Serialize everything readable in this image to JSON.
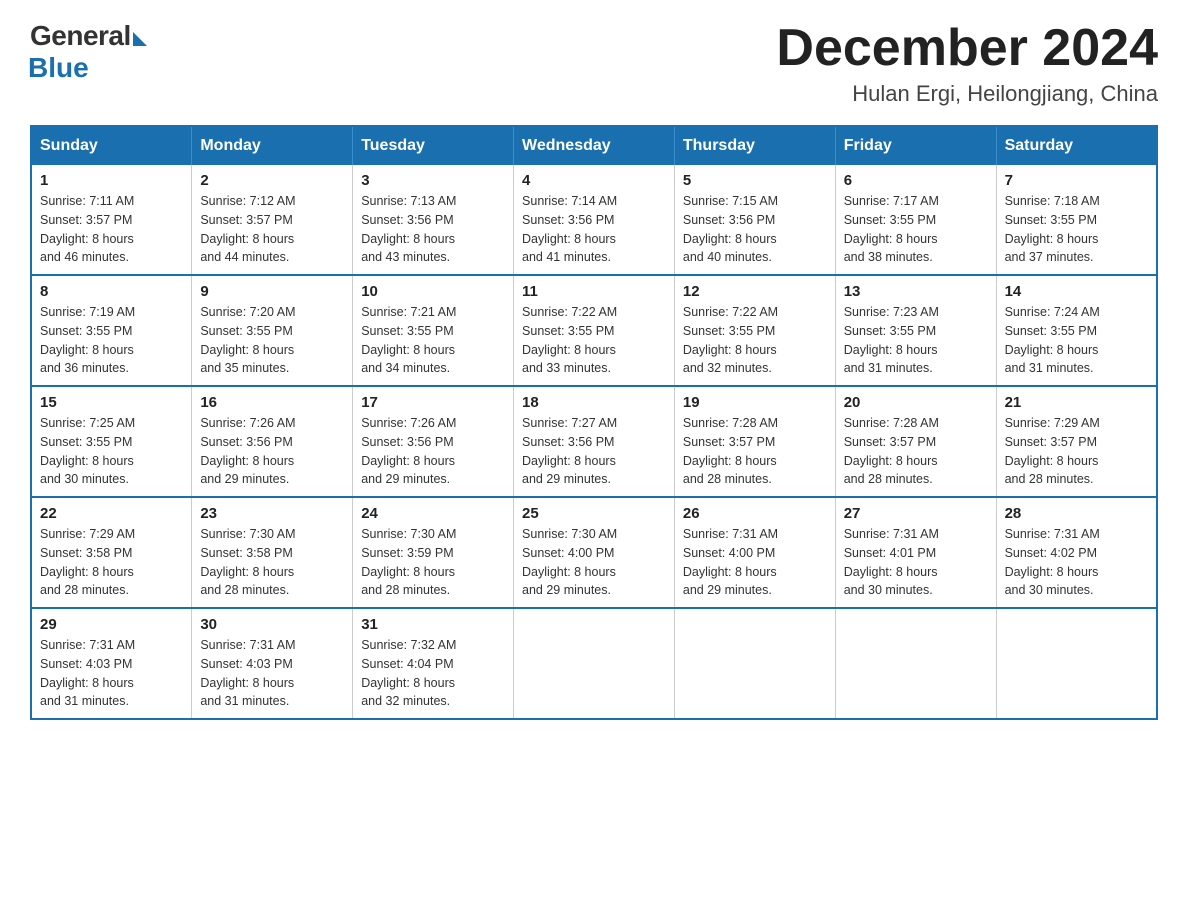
{
  "header": {
    "logo_general": "General",
    "logo_blue": "Blue",
    "month_title": "December 2024",
    "location": "Hulan Ergi, Heilongjiang, China"
  },
  "days_of_week": [
    "Sunday",
    "Monday",
    "Tuesday",
    "Wednesday",
    "Thursday",
    "Friday",
    "Saturday"
  ],
  "weeks": [
    [
      {
        "day": "1",
        "sunrise": "7:11 AM",
        "sunset": "3:57 PM",
        "daylight": "8 hours and 46 minutes."
      },
      {
        "day": "2",
        "sunrise": "7:12 AM",
        "sunset": "3:57 PM",
        "daylight": "8 hours and 44 minutes."
      },
      {
        "day": "3",
        "sunrise": "7:13 AM",
        "sunset": "3:56 PM",
        "daylight": "8 hours and 43 minutes."
      },
      {
        "day": "4",
        "sunrise": "7:14 AM",
        "sunset": "3:56 PM",
        "daylight": "8 hours and 41 minutes."
      },
      {
        "day": "5",
        "sunrise": "7:15 AM",
        "sunset": "3:56 PM",
        "daylight": "8 hours and 40 minutes."
      },
      {
        "day": "6",
        "sunrise": "7:17 AM",
        "sunset": "3:55 PM",
        "daylight": "8 hours and 38 minutes."
      },
      {
        "day": "7",
        "sunrise": "7:18 AM",
        "sunset": "3:55 PM",
        "daylight": "8 hours and 37 minutes."
      }
    ],
    [
      {
        "day": "8",
        "sunrise": "7:19 AM",
        "sunset": "3:55 PM",
        "daylight": "8 hours and 36 minutes."
      },
      {
        "day": "9",
        "sunrise": "7:20 AM",
        "sunset": "3:55 PM",
        "daylight": "8 hours and 35 minutes."
      },
      {
        "day": "10",
        "sunrise": "7:21 AM",
        "sunset": "3:55 PM",
        "daylight": "8 hours and 34 minutes."
      },
      {
        "day": "11",
        "sunrise": "7:22 AM",
        "sunset": "3:55 PM",
        "daylight": "8 hours and 33 minutes."
      },
      {
        "day": "12",
        "sunrise": "7:22 AM",
        "sunset": "3:55 PM",
        "daylight": "8 hours and 32 minutes."
      },
      {
        "day": "13",
        "sunrise": "7:23 AM",
        "sunset": "3:55 PM",
        "daylight": "8 hours and 31 minutes."
      },
      {
        "day": "14",
        "sunrise": "7:24 AM",
        "sunset": "3:55 PM",
        "daylight": "8 hours and 31 minutes."
      }
    ],
    [
      {
        "day": "15",
        "sunrise": "7:25 AM",
        "sunset": "3:55 PM",
        "daylight": "8 hours and 30 minutes."
      },
      {
        "day": "16",
        "sunrise": "7:26 AM",
        "sunset": "3:56 PM",
        "daylight": "8 hours and 29 minutes."
      },
      {
        "day": "17",
        "sunrise": "7:26 AM",
        "sunset": "3:56 PM",
        "daylight": "8 hours and 29 minutes."
      },
      {
        "day": "18",
        "sunrise": "7:27 AM",
        "sunset": "3:56 PM",
        "daylight": "8 hours and 29 minutes."
      },
      {
        "day": "19",
        "sunrise": "7:28 AM",
        "sunset": "3:57 PM",
        "daylight": "8 hours and 28 minutes."
      },
      {
        "day": "20",
        "sunrise": "7:28 AM",
        "sunset": "3:57 PM",
        "daylight": "8 hours and 28 minutes."
      },
      {
        "day": "21",
        "sunrise": "7:29 AM",
        "sunset": "3:57 PM",
        "daylight": "8 hours and 28 minutes."
      }
    ],
    [
      {
        "day": "22",
        "sunrise": "7:29 AM",
        "sunset": "3:58 PM",
        "daylight": "8 hours and 28 minutes."
      },
      {
        "day": "23",
        "sunrise": "7:30 AM",
        "sunset": "3:58 PM",
        "daylight": "8 hours and 28 minutes."
      },
      {
        "day": "24",
        "sunrise": "7:30 AM",
        "sunset": "3:59 PM",
        "daylight": "8 hours and 28 minutes."
      },
      {
        "day": "25",
        "sunrise": "7:30 AM",
        "sunset": "4:00 PM",
        "daylight": "8 hours and 29 minutes."
      },
      {
        "day": "26",
        "sunrise": "7:31 AM",
        "sunset": "4:00 PM",
        "daylight": "8 hours and 29 minutes."
      },
      {
        "day": "27",
        "sunrise": "7:31 AM",
        "sunset": "4:01 PM",
        "daylight": "8 hours and 30 minutes."
      },
      {
        "day": "28",
        "sunrise": "7:31 AM",
        "sunset": "4:02 PM",
        "daylight": "8 hours and 30 minutes."
      }
    ],
    [
      {
        "day": "29",
        "sunrise": "7:31 AM",
        "sunset": "4:03 PM",
        "daylight": "8 hours and 31 minutes."
      },
      {
        "day": "30",
        "sunrise": "7:31 AM",
        "sunset": "4:03 PM",
        "daylight": "8 hours and 31 minutes."
      },
      {
        "day": "31",
        "sunrise": "7:32 AM",
        "sunset": "4:04 PM",
        "daylight": "8 hours and 32 minutes."
      },
      null,
      null,
      null,
      null
    ]
  ],
  "labels": {
    "sunrise": "Sunrise: ",
    "sunset": "Sunset: ",
    "daylight": "Daylight: "
  }
}
